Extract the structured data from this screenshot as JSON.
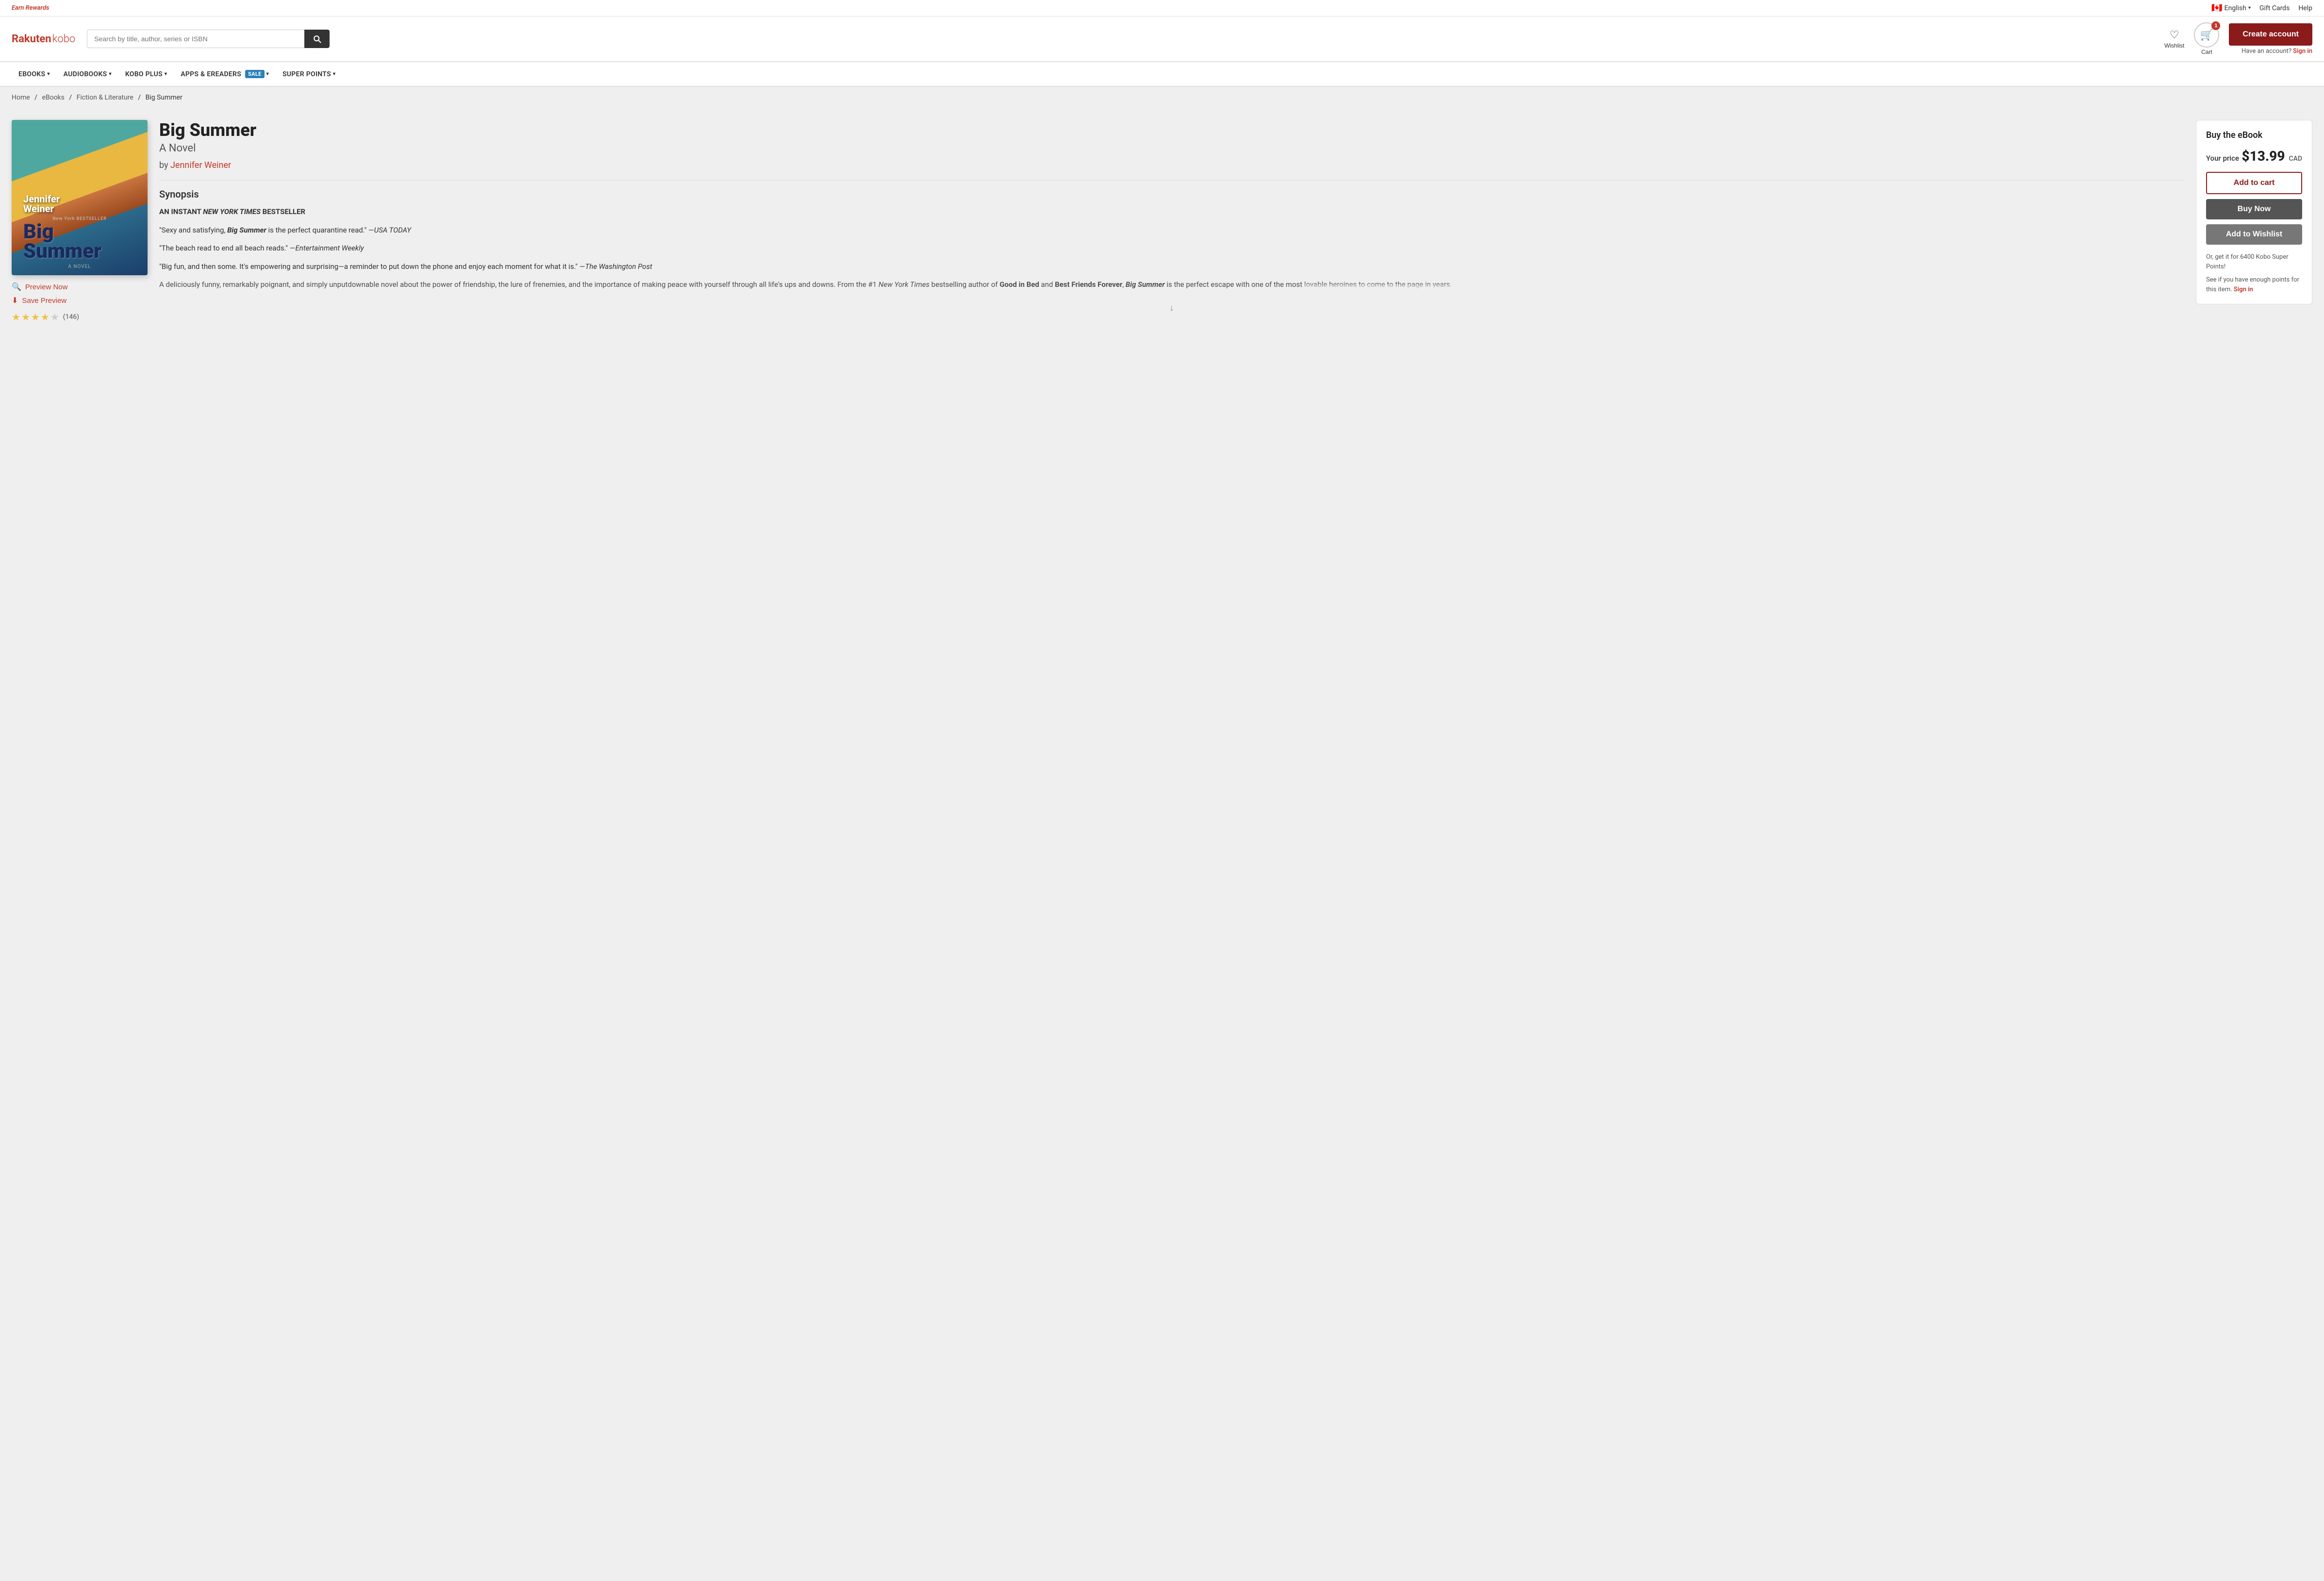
{
  "topbar": {
    "earn_rewards": "Earn Rewards",
    "language": "English",
    "gift_cards": "Gift Cards",
    "help": "Help"
  },
  "header": {
    "logo_rakuten": "Rakuten",
    "logo_kobo": " kobo",
    "search_placeholder": "Search by title, author, series or ISBN",
    "wishlist_label": "Wishlist",
    "cart_label": "Cart",
    "cart_count": "1",
    "create_account": "Create account",
    "have_account": "Have an account?",
    "sign_in": "Sign in"
  },
  "nav": {
    "items": [
      {
        "label": "eBOOKS",
        "has_dropdown": true
      },
      {
        "label": "AUDIOBOOKS",
        "has_dropdown": true
      },
      {
        "label": "KOBO PLUS",
        "has_dropdown": true
      },
      {
        "label": "APPS & eREADERS",
        "has_dropdown": true,
        "badge": "SALE"
      },
      {
        "label": "SUPER POINTS",
        "has_dropdown": true
      }
    ]
  },
  "breadcrumb": {
    "home": "Home",
    "ebooks": "eBooks",
    "category": "Fiction & Literature",
    "current": "Big Summer"
  },
  "book": {
    "title": "Big Summer",
    "subtitle": "A Novel",
    "author": "Jennifer Weiner",
    "cover_author": "Jennifer Weiner",
    "cover_title_line1": "Big",
    "cover_title_line2": "Summer",
    "nyt_text": "New York BESTSELLER",
    "cover_subtitle": "A NOVEL",
    "synopsis_heading": "Synopsis",
    "synopsis_intro": "AN INSTANT NEW YORK TIMES BESTSELLER",
    "quote1": "“Sexy and satisfying, Big Summer is the perfect quarantine read.” —USA TODAY",
    "quote2": "“The beach read to end all beach reads.” —Entertainment Weekly",
    "quote3": "“Big fun, and then some. It’s empowering and surprising—a reminder to put down the phone and enjoy each moment for what it is.” —The Washington Post",
    "synopsis_body": "A deliciously funny, remarkably poignant, and simply unputdownable novel about the power of friendship, the lure of frenemies, and the importance of making peace with yourself through all life’s ups and downs. From the #1 New York Times bestselling author of Good in Bed and Best Friends Forever, Big Summer is the perfect escape with one of the most lovable heroines to come to the page in years.",
    "preview_now": "Preview Now",
    "save_preview": "Save Preview",
    "rating": 3.5,
    "review_count": "(146)"
  },
  "buy_box": {
    "title": "Buy the eBook",
    "your_price_label": "Your price",
    "price": "$13.99",
    "currency": "CAD",
    "add_to_cart": "Add to cart",
    "buy_now": "Buy Now",
    "add_wishlist": "Add to Wishlist",
    "kobo_points_text": "Or, get it for 6400 Kobo Super Points!",
    "points_check": "See if you have enough points for this item.",
    "sign_in": "Sign in"
  }
}
